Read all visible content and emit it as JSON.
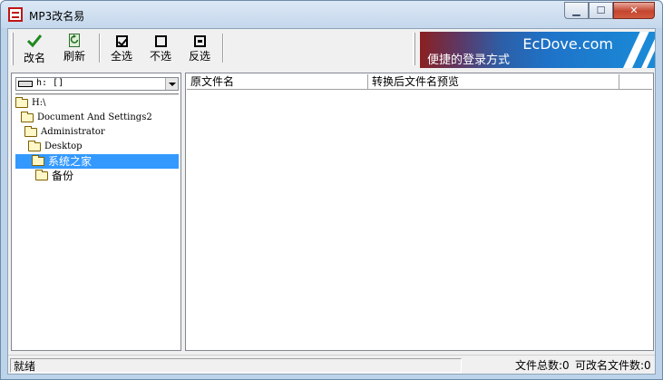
{
  "window": {
    "title": "MP3改名易"
  },
  "toolbar": {
    "rename_label": "改名",
    "refresh_label": "刷新",
    "select_all_label": "全选",
    "select_none_label": "不选",
    "invert_label": "反选"
  },
  "banner": {
    "brand": "EcDove.com",
    "slogan": "便捷的登录方式"
  },
  "drive": {
    "selected": "h: []"
  },
  "tree": {
    "items": [
      {
        "label": "H:\\"
      },
      {
        "label": "Document And Settings2"
      },
      {
        "label": "Administrator"
      },
      {
        "label": "Desktop"
      },
      {
        "label": "系统之家"
      },
      {
        "label": "备份"
      }
    ]
  },
  "file_list": {
    "columns": [
      "原文件名",
      "转换后文件名预览"
    ]
  },
  "status": {
    "state": "就绪",
    "total_files": "文件总数:0",
    "renamable_files": "可改名文件数:0"
  },
  "colors": {
    "selection": "#3399ff",
    "title_bar": "#c4d7ec",
    "close_button": "#c4452e",
    "app_icon": "#c01515"
  },
  "icons": {
    "app": "mp3-app-icon",
    "rename": "checkmark-icon",
    "refresh": "refresh-icon",
    "select_all": "checked-box-icon",
    "select_none": "empty-box-icon",
    "invert": "invert-box-icon",
    "drive": "drive-icon",
    "folder": "folder-icon"
  }
}
